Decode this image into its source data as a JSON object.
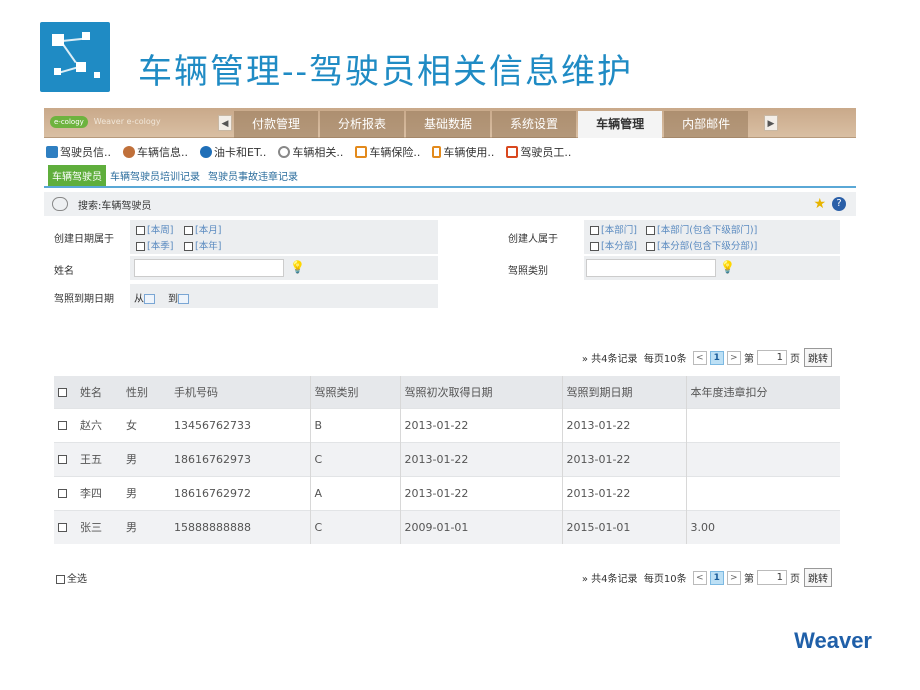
{
  "slide": {
    "title": "车辆管理--驾驶员相关信息维护",
    "footer_brand": "Weaver"
  },
  "topbar": {
    "brand_badge": "e-cology",
    "brand_text": "Weaver e-cology",
    "tabs": [
      "付款管理",
      "分析报表",
      "基础数据",
      "系统设置",
      "车辆管理",
      "内部邮件"
    ],
    "active_tab": "车辆管理"
  },
  "toolbar": {
    "items": [
      {
        "label": "驾驶员信..",
        "icon": "up-arrow-icon"
      },
      {
        "label": "车辆信息..",
        "icon": "user-icon"
      },
      {
        "label": "油卡和ET..",
        "icon": "globe-icon"
      },
      {
        "label": "车辆相关..",
        "icon": "search-icon"
      },
      {
        "label": "车辆保险..",
        "icon": "document-icon"
      },
      {
        "label": "车辆使用..",
        "icon": "list-icon"
      },
      {
        "label": "驾驶员工..",
        "icon": "form-icon"
      }
    ]
  },
  "subtabs": [
    "车辆驾驶员",
    "车辆驾驶员培训记录",
    "驾驶员事故违章记录"
  ],
  "search": {
    "label": "搜索:车辆驾驶员"
  },
  "form": {
    "created_date_label": "创建日期属于",
    "created_date_options": [
      "[本周]",
      "[本月]",
      "[本季]",
      "[本年]"
    ],
    "creator_label": "创建人属于",
    "creator_options": [
      "[本部门]",
      "[本部门(包含下级部门)]",
      "[本分部]",
      "[本分部(包含下级分部)]"
    ],
    "name_label": "姓名",
    "name_value": "",
    "license_type_label": "驾照类别",
    "license_type_value": "",
    "expiry_label": "驾照到期日期",
    "from_label": "从",
    "to_label": "到"
  },
  "pager": {
    "summary": "» 共4条记录",
    "per_page": "每页10条",
    "prev": "<",
    "current": "1",
    "next": ">",
    "page_prefix": "第",
    "page_input": "1",
    "page_suffix": "页",
    "jump": "跳转"
  },
  "table": {
    "columns": [
      "姓名",
      "性别",
      "手机号码",
      "驾照类别",
      "驾照初次取得日期",
      "驾照到期日期",
      "本年度违章扣分"
    ],
    "rows": [
      [
        "赵六",
        "女",
        "13456762733",
        "B",
        "2013-01-22",
        "2013-01-22",
        ""
      ],
      [
        "王五",
        "男",
        "18616762973",
        "C",
        "2013-01-22",
        "2013-01-22",
        ""
      ],
      [
        "李四",
        "男",
        "18616762972",
        "A",
        "2013-01-22",
        "2013-01-22",
        ""
      ],
      [
        "张三",
        "男",
        "15888888888",
        "C",
        "2009-01-01",
        "2015-01-01",
        "3.00"
      ]
    ]
  },
  "select_all_label": "全选"
}
